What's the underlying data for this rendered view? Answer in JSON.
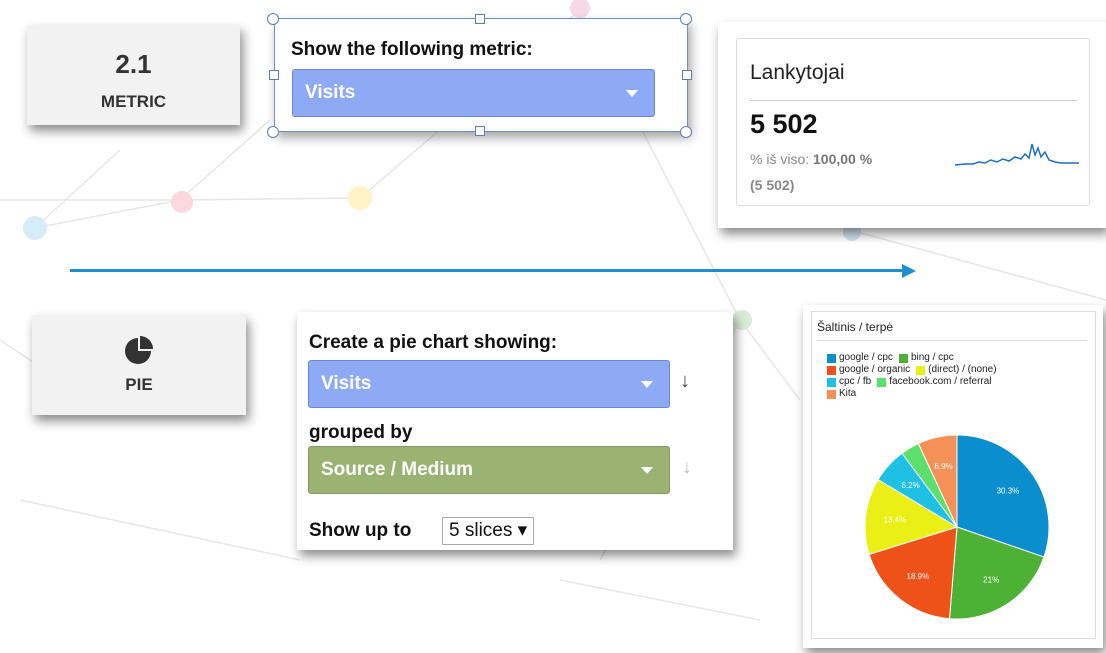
{
  "metric_tile": {
    "title": "2.1",
    "label": "METRIC"
  },
  "metric_panel": {
    "prompt": "Show the following metric:",
    "selected": "Visits"
  },
  "ga_card": {
    "title": "Lankytojai",
    "value": "5 502",
    "pct_prefix": "% iš viso:",
    "pct_value": "100,00 %",
    "total": "(5 502)"
  },
  "pie_tile": {
    "label": "PIE",
    "icon": "pie-chart-icon"
  },
  "pie_panel": {
    "prompt": "Create a pie chart showing:",
    "metric_selected": "Visits",
    "grouped_label": "grouped by",
    "group_selected": "Source / Medium",
    "show_up_to_label": "Show up to",
    "slices_selected": "5 slices ▾"
  },
  "chart_data": {
    "type": "pie",
    "title": "Šaltinis / terpė",
    "legend_position": "top",
    "series": [
      {
        "name": "google / cpc",
        "value": 30.3,
        "label": "30.3%",
        "color": "#0b8ecd"
      },
      {
        "name": "bing / cpc",
        "value": 21.0,
        "label": "21%",
        "color": "#4cb135"
      },
      {
        "name": "google / organic",
        "value": 18.9,
        "label": "18.9%",
        "color": "#ef5219"
      },
      {
        "name": "(direct) / (none)",
        "value": 13.4,
        "label": "13.4%",
        "color": "#eaef16"
      },
      {
        "name": "cpc / fb",
        "value": 6.2,
        "label": "6.2%",
        "color": "#1ec0e3"
      },
      {
        "name": "facebook.com / referral",
        "value": 3.3,
        "label": "",
        "color": "#5de06b"
      },
      {
        "name": "Kita",
        "value": 6.9,
        "label": "6.9%",
        "color": "#f59058"
      }
    ]
  },
  "colors": {
    "arrow": "#1f8fd1",
    "dropdown_blue": "#8eaaf4",
    "dropdown_green": "#9ab272"
  }
}
